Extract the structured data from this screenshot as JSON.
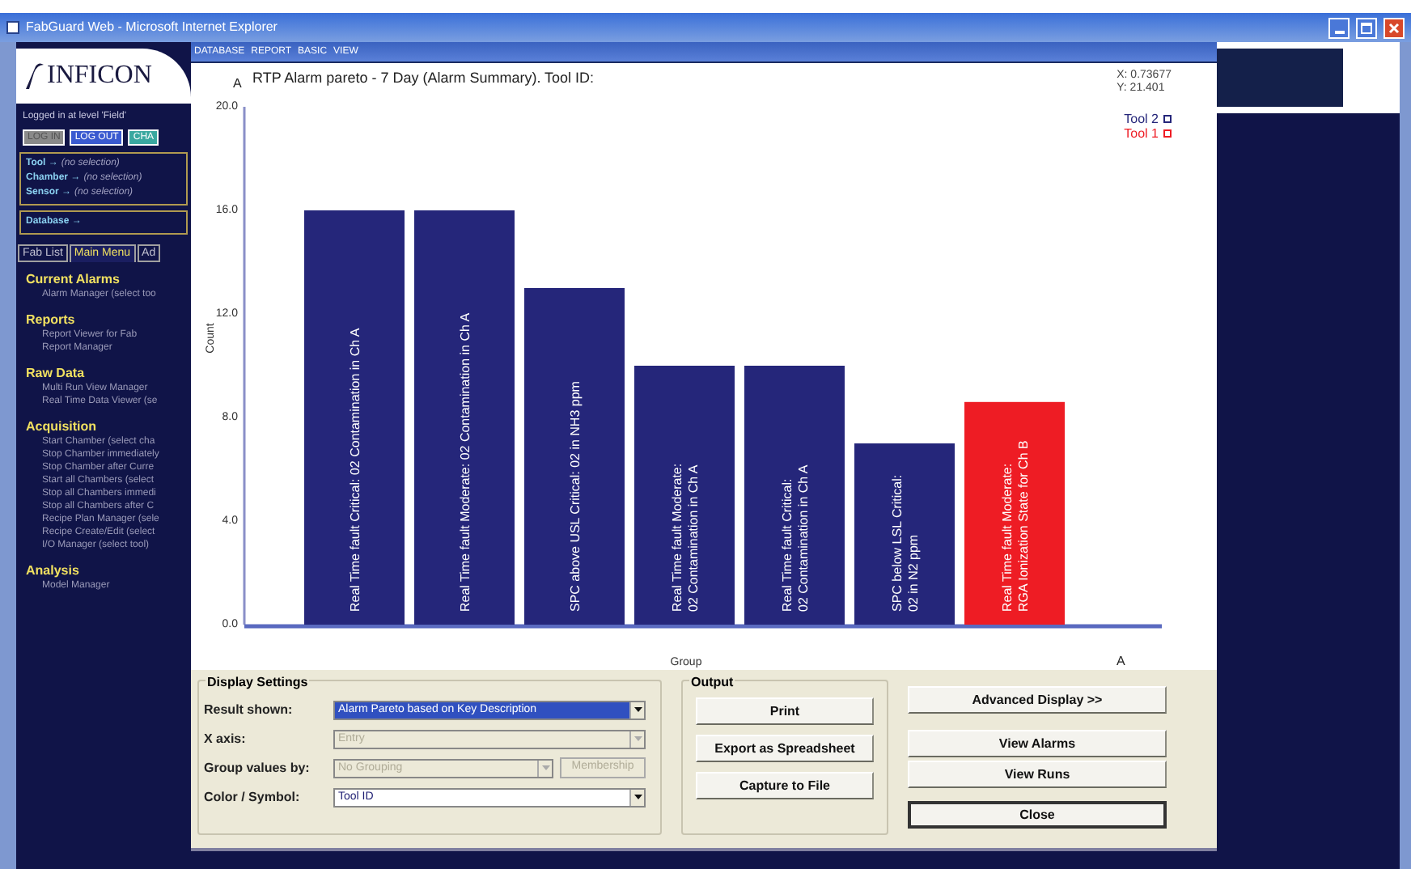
{
  "window": {
    "title": "FabGuard Web - Microsoft Internet Explorer"
  },
  "sidebar": {
    "logo": "INFICON",
    "login_status": "Logged in at level 'Field'",
    "buttons": [
      {
        "label": "LOG IN",
        "disabled": true,
        "color": "#8a8a8a"
      },
      {
        "label": "LOG OUT",
        "disabled": false,
        "color": "#3a5ad0"
      },
      {
        "label": "CHA",
        "disabled": false,
        "color": "#3aa8a0"
      }
    ],
    "selections": [
      {
        "label": "Tool →",
        "value": "(no selection)"
      },
      {
        "label": "Chamber →",
        "value": "(no selection)"
      },
      {
        "label": "Sensor →",
        "value": "(no selection)"
      }
    ],
    "database": "Database →",
    "tabs": [
      {
        "label": "Fab List",
        "selected": false
      },
      {
        "label": "Main Menu",
        "selected": true
      },
      {
        "label": "Ad",
        "selected": false
      }
    ],
    "sections": [
      {
        "title": "Current Alarms",
        "items": [
          "Alarm Manager (select too"
        ]
      },
      {
        "title": "Reports",
        "items": [
          "Report Viewer for Fab",
          "Report Manager"
        ]
      },
      {
        "title": "Raw Data",
        "items": [
          "Multi Run View Manager",
          "Real Time Data Viewer (se"
        ]
      },
      {
        "title": "Acquisition",
        "items": [
          "Start Chamber (select cha",
          "Stop Chamber immediately",
          "Stop Chamber after Curre",
          "Start all Chambers (select",
          "Stop all Chambers immedi",
          "Stop all Chambers after C",
          "Recipe Plan Manager (sele",
          "Recipe Create/Edit (select",
          "I/O Manager (select tool)"
        ]
      },
      {
        "title": "Analysis",
        "items": [
          "Model Manager"
        ]
      }
    ]
  },
  "menu": [
    "DATABASE",
    "REPORT",
    "BASIC",
    "VIEW"
  ],
  "chart": {
    "axis_marks": [
      "A",
      "A"
    ],
    "readout": [
      "X: 0.73677",
      "Y: 21.401"
    ],
    "chart_data": {
      "type": "bar",
      "title": "RTP Alarm pareto - 7 Day (Alarm Summary). Tool ID:",
      "xlabel": "Group",
      "ylabel": "Count",
      "categories": [
        "Real Time fault Critical: 02 Contamination in Ch A",
        "Real Time fault Moderate: 02 Contamination in Ch A",
        "SPC above USL Critical: 02 in NH3 ppm",
        "Real Time fault Moderate: 02 Contamination in Ch A",
        "Real Time fault Critical: 02 Contamination in Ch A",
        "SPC below LSL Critical: 02 in N2 ppm",
        "Real Time fault Moderate: RGA Ionization State for Ch B"
      ],
      "series": [
        {
          "name": "Tool 2",
          "color": "#25267a",
          "values": [
            16,
            16,
            13,
            10,
            10,
            7,
            null
          ]
        },
        {
          "name": "Tool 1",
          "color": "#ee1c24",
          "values": [
            null,
            null,
            null,
            null,
            null,
            null,
            8.6
          ]
        }
      ],
      "ylim": [
        0,
        20
      ],
      "yticks": [
        {
          "value": 0,
          "label": "0.0"
        },
        {
          "value": 4,
          "label": "4.0"
        },
        {
          "value": 8,
          "label": "8.0"
        },
        {
          "value": 12,
          "label": "12.0"
        },
        {
          "value": 16,
          "label": "16.0"
        },
        {
          "value": 20,
          "label": "20.0"
        }
      ],
      "legend": "upper right"
    }
  },
  "display_settings": {
    "title": "Display Settings",
    "rows": [
      {
        "label": "Result shown:",
        "value": "Alarm Pareto based on Key Description",
        "disabled": false,
        "highlighted": true
      },
      {
        "label": "X axis:",
        "value": "Entry",
        "disabled": true,
        "highlighted": false
      },
      {
        "label": "Group values by:",
        "value": "No Grouping",
        "disabled": true,
        "highlighted": false,
        "button": "Membership"
      },
      {
        "label": "Color / Symbol:",
        "value": "Tool ID",
        "disabled": false,
        "highlighted": false
      }
    ]
  },
  "output": {
    "title": "Output",
    "buttons": [
      "Print",
      "Export as Spreadsheet",
      "Capture to File"
    ]
  },
  "actions": [
    {
      "label": "Advanced Display >>",
      "default": false
    },
    {
      "label": "View Alarms",
      "default": false
    },
    {
      "label": "View Runs",
      "default": false
    },
    {
      "label": "Close",
      "default": true
    }
  ]
}
